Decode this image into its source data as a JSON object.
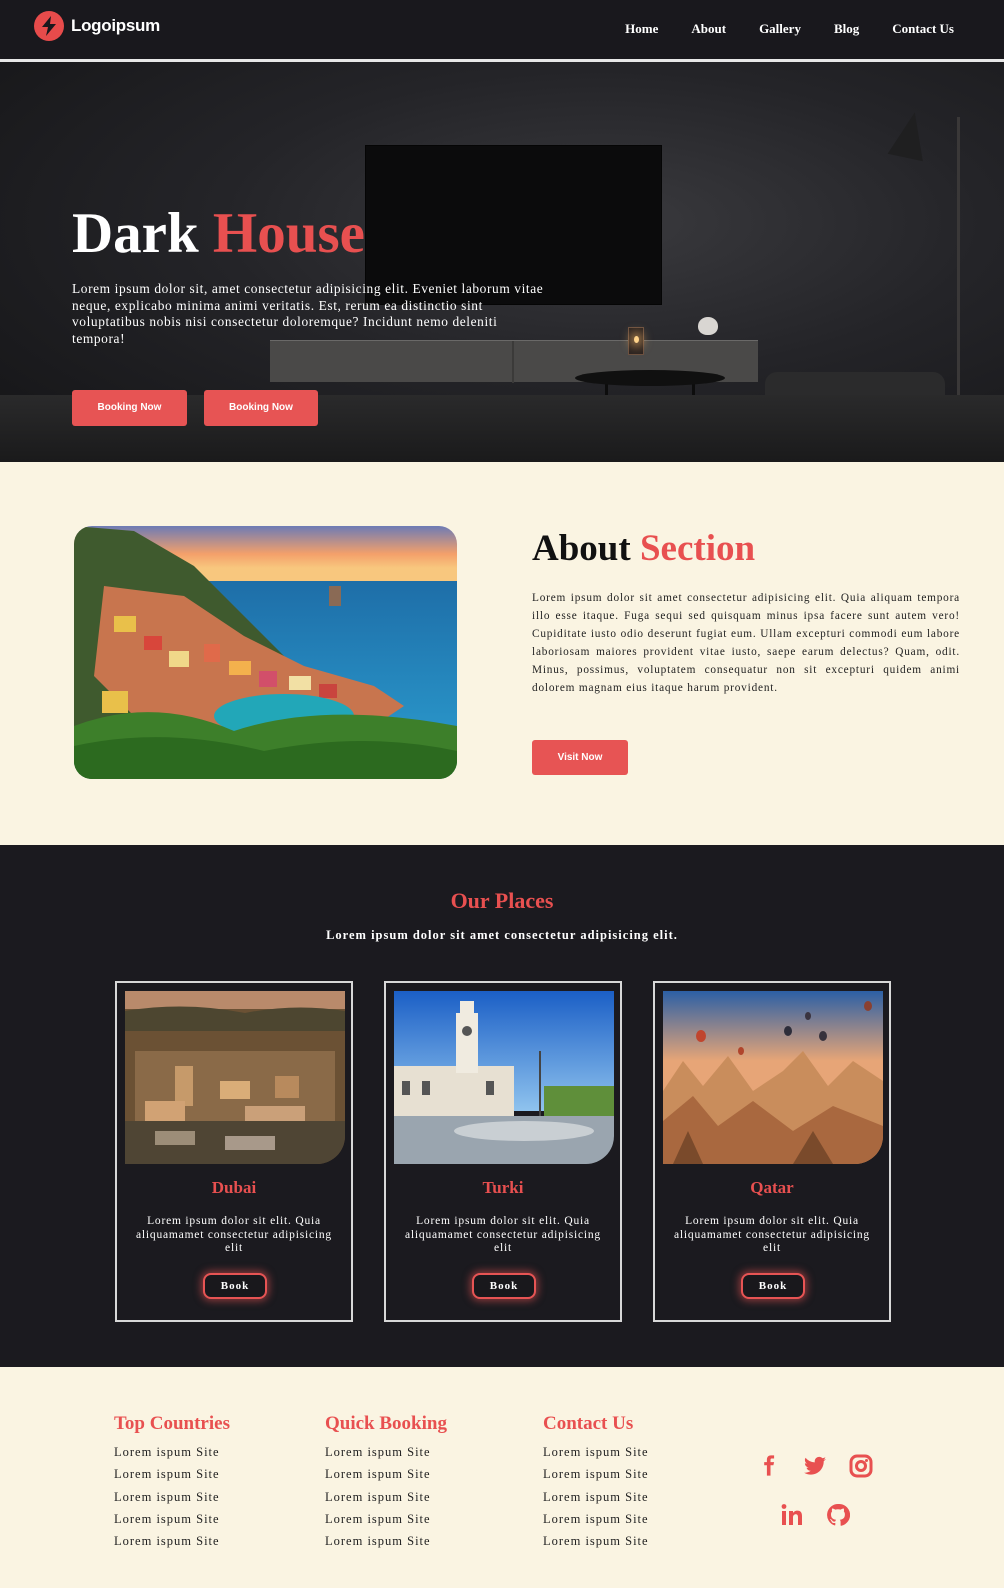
{
  "nav": {
    "brand": "Logoipsum",
    "links": [
      "Home",
      "About",
      "Gallery",
      "Blog",
      "Contact Us"
    ]
  },
  "hero": {
    "title_main": "Dark",
    "title_accent": "House",
    "text": "Lorem ipsum dolor sit, amet consectetur adipisicing elit. Eveniet laborum vitae neque, explicabo minima animi veritatis. Est, rerum ea distinctio sint voluptatibus nobis nisi consectetur doloremque? Incidunt nemo deleniti tempora!",
    "buttons": [
      "Booking Now",
      "Booking Now"
    ]
  },
  "about": {
    "title_main": "About",
    "title_accent": "Section",
    "text": "Lorem ipsum dolor sit amet consectetur adipisicing elit. Quia aliquam tempora illo esse itaque. Fuga sequi sed quisquam minus ipsa facere sunt autem vero! Cupiditate iusto odio deserunt fugiat eum. Ullam excepturi commodi eum labore laboriosam maiores provident vitae iusto, saepe earum delectus? Quam, odit. Minus, possimus, voluptatem consequatur non sit excepturi quidem animi dolorem magnam eius itaque harum provident.",
    "button": "Visit Now"
  },
  "places": {
    "title": "Our Places",
    "subtitle": "Lorem ipsum dolor sit amet consectetur adipisicing elit.",
    "cards": [
      {
        "name": "Dubai",
        "text": "Lorem ipsum dolor sit elit. Quia aliquamamet consectetur adipisicing elit",
        "button": "Book"
      },
      {
        "name": "Turki",
        "text": "Lorem ipsum dolor sit elit. Quia aliquamamet consectetur adipisicing elit",
        "button": "Book"
      },
      {
        "name": "Qatar",
        "text": "Lorem ipsum dolor sit elit. Quia aliquamamet consectetur adipisicing elit",
        "button": "Book"
      }
    ]
  },
  "footer": {
    "columns": [
      {
        "title": "Top Countries",
        "links": [
          "Lorem ispum Site",
          "Lorem ispum Site",
          "Lorem ispum Site",
          "Lorem ispum Site",
          "Lorem ispum Site"
        ]
      },
      {
        "title": "Quick Booking",
        "links": [
          "Lorem ispum Site",
          "Lorem ispum Site",
          "Lorem ispum Site",
          "Lorem ispum Site",
          "Lorem ispum Site"
        ]
      },
      {
        "title": "Contact Us",
        "links": [
          "Lorem ispum Site",
          "Lorem ispum Site",
          "Lorem ispum Site",
          "Lorem ispum Site",
          "Lorem ispum Site"
        ]
      }
    ],
    "social_icons": [
      "facebook-icon",
      "twitter-icon",
      "instagram-icon",
      "linkedin-icon",
      "github-icon"
    ]
  },
  "colors": {
    "accent": "#e85050",
    "dark": "#1b1a1f",
    "cream": "#faf4e2"
  }
}
